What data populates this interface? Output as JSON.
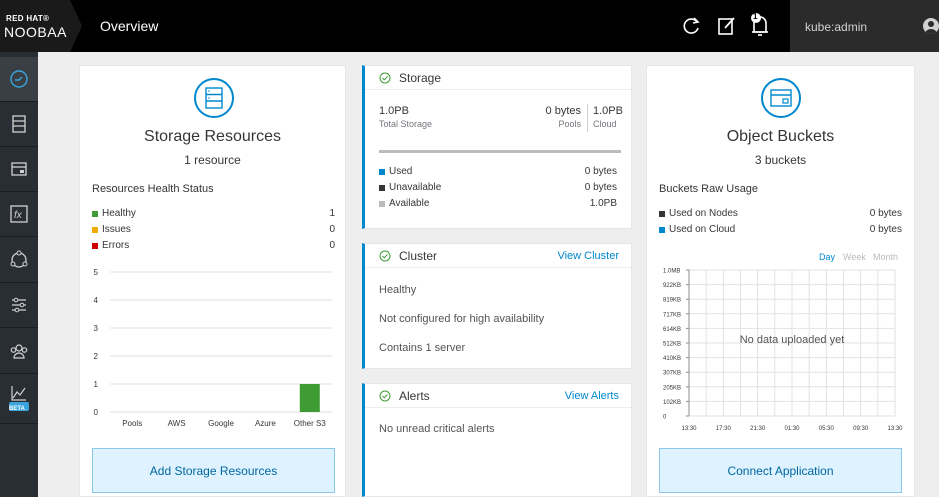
{
  "brand": {
    "top": "RED HAT®",
    "name": "NOOBAA"
  },
  "header": {
    "page_title": "Overview",
    "user": "kube:admin",
    "notification_count": "1"
  },
  "sidebar": {
    "items": [
      "dashboard-icon",
      "storage-icon",
      "bucket-icon",
      "function-icon",
      "cluster-icon",
      "settings-sliders-icon",
      "accounts-icon",
      "analytics-icon"
    ],
    "beta_label": "BETA"
  },
  "storage_resources": {
    "title": "Storage Resources",
    "subtitle": "1 resource",
    "health_title": "Resources Health Status",
    "health": [
      {
        "label": "Healthy",
        "value": "1",
        "color": "#3f9c35"
      },
      {
        "label": "Issues",
        "value": "0",
        "color": "#f0ab00"
      },
      {
        "label": "Errors",
        "value": "0",
        "color": "#cc0000"
      }
    ],
    "button": "Add Storage Resources"
  },
  "chart_data": {
    "type": "bar",
    "categories": [
      "Pools",
      "AWS",
      "Google",
      "Azure",
      "Other S3"
    ],
    "values": [
      0,
      0,
      0,
      0,
      1
    ],
    "yticks": [
      "0",
      "1",
      "2",
      "3",
      "4",
      "5"
    ],
    "ylim": [
      0,
      5
    ],
    "bar_color": "#3f9c35",
    "title": "",
    "xlabel": "",
    "ylabel": ""
  },
  "storage": {
    "title": "Storage",
    "total_value": "1.0PB",
    "total_label": "Total Storage",
    "pools_value": "0 bytes",
    "pools_label": "Pools",
    "cloud_value": "1.0PB",
    "cloud_label": "Cloud",
    "rows": [
      {
        "label": "Used",
        "value": "0 bytes",
        "color": "#0088ce"
      },
      {
        "label": "Unavailable",
        "value": "0 bytes",
        "color": "#363636"
      },
      {
        "label": "Available",
        "value": "1.0PB",
        "color": "#bbbbbb"
      }
    ]
  },
  "cluster": {
    "title": "Cluster",
    "link": "View Cluster",
    "lines": [
      "Healthy",
      "Not configured for high availability",
      "Contains 1 server"
    ]
  },
  "alerts": {
    "title": "Alerts",
    "link": "View Alerts",
    "message": "No unread critical alerts"
  },
  "object_buckets": {
    "title": "Object Buckets",
    "subtitle": "3 buckets",
    "usage_title": "Buckets Raw Usage",
    "rows": [
      {
        "label": "Used on Nodes",
        "value": "0 bytes",
        "color": "#363636"
      },
      {
        "label": "Used on Cloud",
        "value": "0 bytes",
        "color": "#0088ce"
      }
    ],
    "periods": [
      "Day",
      "Week",
      "Month"
    ],
    "active_period": "Day",
    "yticks": [
      "1.0MB",
      "922KB",
      "819KB",
      "717KB",
      "614KB",
      "512KB",
      "410KB",
      "307KB",
      "205KB",
      "102KB",
      "0"
    ],
    "xticks": [
      "13:30",
      "17:30",
      "21:30",
      "01:30",
      "05:30",
      "09:30",
      "13:30"
    ],
    "empty_msg": "No data uploaded yet",
    "button": "Connect Application"
  }
}
